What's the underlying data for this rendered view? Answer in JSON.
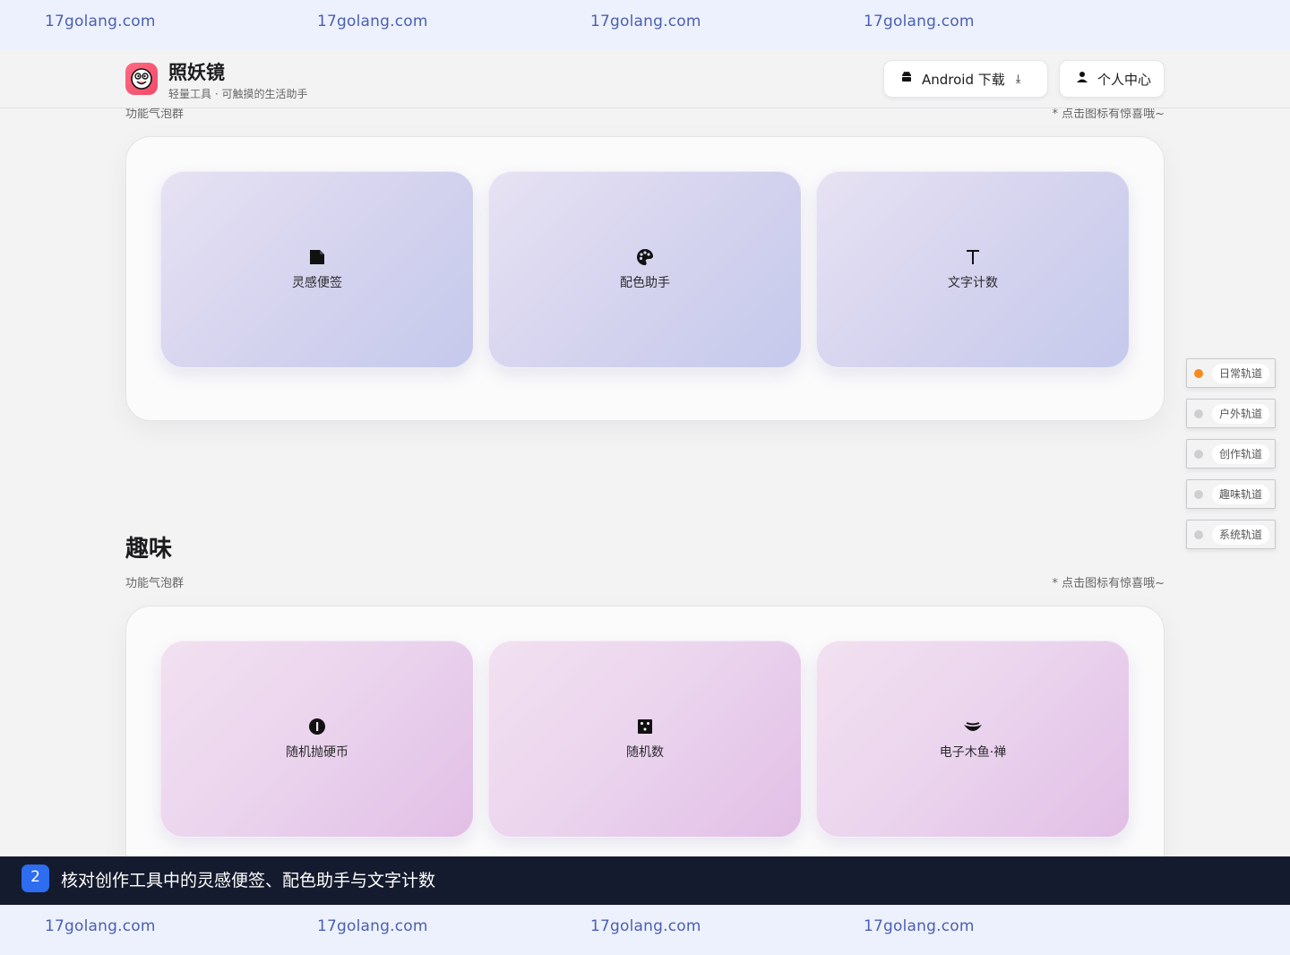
{
  "watermarks": [
    "17golang.com",
    "17golang.com",
    "17golang.com",
    "17golang.com"
  ],
  "header": {
    "app_name": "照妖镜",
    "app_subtitle": "轻量工具 · 可触摸的生活助手",
    "android_label": "Android 下载",
    "android_icon": "android-icon",
    "download_icon": "download-icon",
    "user_label": "个人中心",
    "user_icon": "user-icon"
  },
  "sections": [
    {
      "subtitle": "功能气泡群",
      "hint": "* 点击图标有惊喜哦~",
      "cards": [
        {
          "label": "灵感便签",
          "icon": "note-icon"
        },
        {
          "label": "配色助手",
          "icon": "palette-icon"
        },
        {
          "label": "文字计数",
          "icon": "text-icon"
        }
      ]
    },
    {
      "title": "趣味",
      "subtitle": "功能气泡群",
      "hint": "* 点击图标有惊喜哦~",
      "cards": [
        {
          "label": "随机抛硬币",
          "icon": "coin-icon"
        },
        {
          "label": "随机数",
          "icon": "dice-icon"
        },
        {
          "label": "电子木鱼·禅",
          "icon": "wooden-fish-icon"
        }
      ]
    }
  ],
  "rails": [
    {
      "label": "日常轨道",
      "active": true
    },
    {
      "label": "户外轨道",
      "active": false
    },
    {
      "label": "创作轨道",
      "active": false
    },
    {
      "label": "趣味轨道",
      "active": false
    },
    {
      "label": "系统轨道",
      "active": false
    }
  ],
  "caption": {
    "step": "2",
    "text": "核对创作工具中的灵感便签、配色助手与文字计数"
  },
  "colors": {
    "accent_active": "#f58a1f",
    "caption_bg": "#151b2e",
    "step_badge": "#2e6cf0",
    "watermark_bar": "#edf1fd"
  }
}
